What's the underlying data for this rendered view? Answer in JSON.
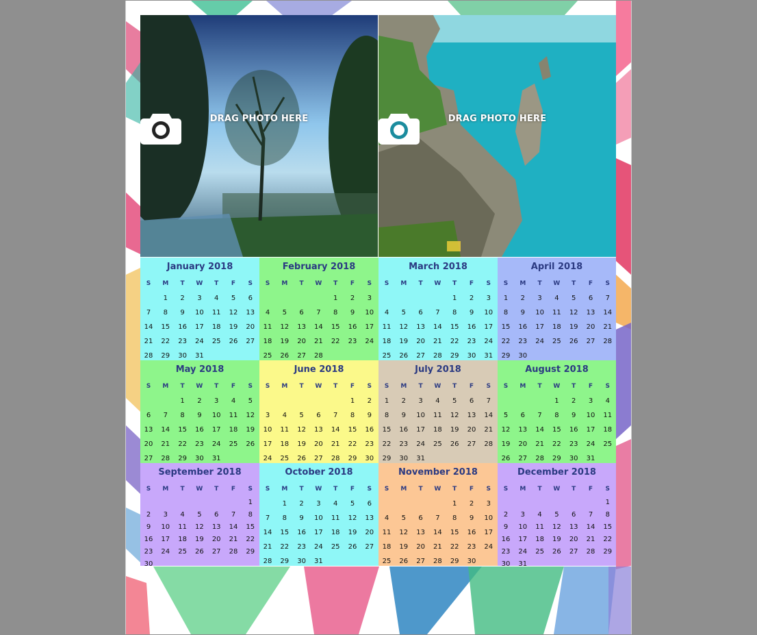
{
  "photo_placeholders": [
    {
      "label": "DRAG PHOTO HERE",
      "icon": "camera-icon"
    },
    {
      "label": "DRAG PHOTO HERE",
      "icon": "camera-icon"
    }
  ],
  "calendar": {
    "year": "2018",
    "weekday_headers": [
      "S",
      "M",
      "T",
      "W",
      "T",
      "F",
      "S"
    ],
    "months": [
      {
        "title": "January 2018",
        "color": "#8ff7f7",
        "start": 1,
        "days": 31
      },
      {
        "title": "February 2018",
        "color": "#8ef58b",
        "start": 4,
        "days": 28
      },
      {
        "title": "March 2018",
        "color": "#8ff7f7",
        "start": 4,
        "days": 31
      },
      {
        "title": "April 2018",
        "color": "#a6b9f9",
        "start": 0,
        "days": 30
      },
      {
        "title": "May 2018",
        "color": "#8ef58b",
        "start": 2,
        "days": 31
      },
      {
        "title": "June 2018",
        "color": "#fbf98a",
        "start": 5,
        "days": 30
      },
      {
        "title": "July 2018",
        "color": "#d8cbb6",
        "start": 0,
        "days": 31
      },
      {
        "title": "August 2018",
        "color": "#8ef58b",
        "start": 3,
        "days": 31
      },
      {
        "title": "September 2018",
        "color": "#c8a8fb",
        "start": 6,
        "days": 30
      },
      {
        "title": "October 2018",
        "color": "#8ff7f7",
        "start": 1,
        "days": 31
      },
      {
        "title": "November 2018",
        "color": "#fcc795",
        "start": 4,
        "days": 30
      },
      {
        "title": "December 2018",
        "color": "#c8a8fb",
        "start": 6,
        "days": 31
      }
    ]
  }
}
